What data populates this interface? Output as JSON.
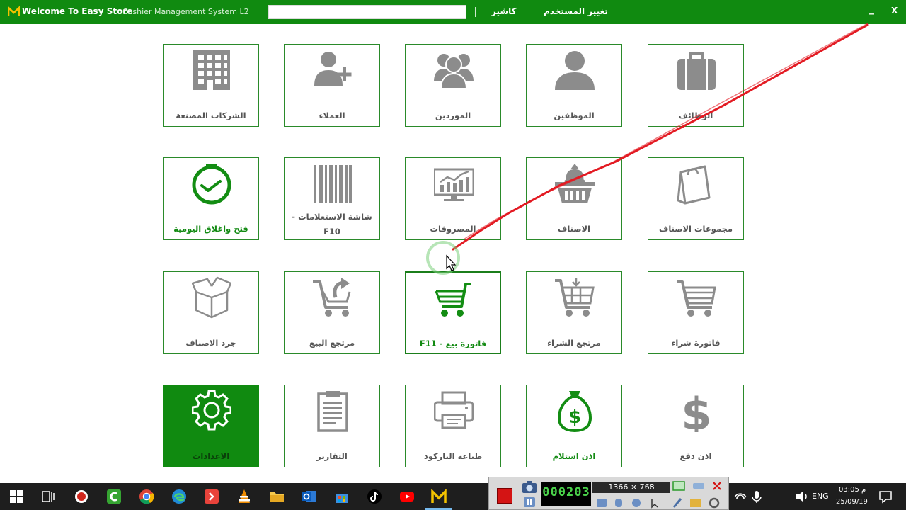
{
  "titlebar": {
    "app_title": "Welcome To Easy Store",
    "subtitle": "Cashier Management System L2",
    "search_value": "",
    "cashier_label": "كاشير",
    "change_user_label": "تغيير المستخدم",
    "minimize_label": "_",
    "close_label": "X"
  },
  "tiles": [
    {
      "label": "الشركات المصنعة",
      "icon": "building-icon"
    },
    {
      "label": "العملاء",
      "icon": "add-user-icon"
    },
    {
      "label": "الموردين",
      "icon": "group-icon"
    },
    {
      "label": "الموظفين",
      "icon": "user-icon"
    },
    {
      "label": "الوظائف",
      "icon": "briefcase-icon"
    },
    {
      "label": "فتح واغلاق اليومية",
      "icon": "clock-icon"
    },
    {
      "label": "- شاشة الاستعلامات F10",
      "icon": "barcode-icon"
    },
    {
      "label": "المصروفات",
      "icon": "monitor-chart-icon"
    },
    {
      "label": "الاصناف",
      "icon": "basket-icon"
    },
    {
      "label": "مجموعات الاصناف",
      "icon": "bag-icon"
    },
    {
      "label": "جرد الاصناف",
      "icon": "open-box-icon"
    },
    {
      "label": "مرتجع البيع",
      "icon": "cart-return-icon"
    },
    {
      "label": "F11 - فاتورة بيع",
      "icon": "cart-icon"
    },
    {
      "label": "مرتجع الشراء",
      "icon": "cart-grid-icon"
    },
    {
      "label": "فاتورة شراء",
      "icon": "cart-outline-icon"
    },
    {
      "label": "الاعدادات",
      "icon": "gear-icon"
    },
    {
      "label": "التقارير",
      "icon": "clipboard-icon"
    },
    {
      "label": "طباعة الباركود",
      "icon": "printer-icon"
    },
    {
      "label": "اذن استلام",
      "icon": "money-bag-icon"
    },
    {
      "label": "اذن دفع",
      "icon": "dollar-icon"
    }
  ],
  "recorder": {
    "timer": "000203",
    "resolution": "1366 × 768"
  },
  "tray": {
    "language": "ENG",
    "time": "03:05 م",
    "date": "25/09/19"
  }
}
